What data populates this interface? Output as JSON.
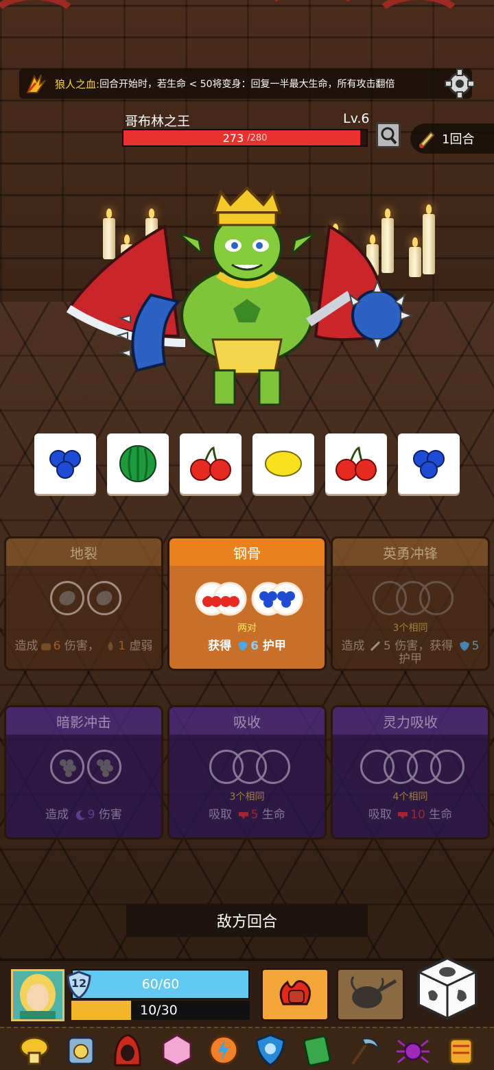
{
  "trait": {
    "icon": "werewolf-claw-icon",
    "name": "狼人之血:",
    "description": "回合开始时，若生命 < 50将变身：回复一半最大生命，所有攻击翻倍"
  },
  "settings_icon": "gear-icon",
  "enemy": {
    "name": "哥布林之王",
    "level": "Lv.6",
    "hp_current": "273",
    "hp_max": "/280",
    "hp_fraction": 0.975
  },
  "round": {
    "label": "1回合",
    "icon": "scroll-icon"
  },
  "dice": [
    {
      "face": "blueberry"
    },
    {
      "face": "watermelon"
    },
    {
      "face": "cherry"
    },
    {
      "face": "lemon"
    },
    {
      "face": "cherry"
    },
    {
      "face": "blueberry"
    }
  ],
  "skills": [
    {
      "title": "地裂",
      "theme": "brown",
      "slots": [
        "nut",
        "nut"
      ],
      "requirement": "",
      "effect_a": "造成",
      "value_a": "6",
      "effect_b": "伤害，",
      "value_b": "1",
      "effect_c": "虚弱"
    },
    {
      "title": "钢骨",
      "theme": "orange",
      "slots": [
        "cherry",
        "cherry",
        "blueberry",
        "blueberry"
      ],
      "requirement": "两对",
      "effect_a": "获得",
      "value_a": "6",
      "effect_b": "护甲"
    },
    {
      "title": "英勇冲锋",
      "theme": "brown",
      "slots": [
        "",
        "",
        ""
      ],
      "requirement": "3个相同",
      "effect_a": "造成",
      "value_a": "5",
      "effect_b": "伤害，获得",
      "value_b": "5",
      "effect_c": "护甲"
    },
    {
      "title": "暗影冲击",
      "theme": "purple",
      "slots": [
        "grape",
        "grape"
      ],
      "requirement": "",
      "effect_a": "造成",
      "value_a": "9",
      "effect_b": "伤害"
    },
    {
      "title": "吸收",
      "theme": "purple",
      "slots": [
        "",
        "",
        ""
      ],
      "requirement": "3个相同",
      "effect_a": "吸取",
      "value_a": "5",
      "effect_b": "生命"
    },
    {
      "title": "灵力吸收",
      "theme": "purple",
      "slots": [
        "",
        "",
        "",
        ""
      ],
      "requirement": "4个相同",
      "effect_a": "吸取",
      "value_a": "10",
      "effect_b": "生命"
    }
  ],
  "turn_banner": "敌方回合",
  "player": {
    "level": "12",
    "hp_text": "60/60",
    "hp_fraction": 1.0,
    "xp_text": "10/30",
    "xp_fraction": 0.333
  },
  "abilities": [
    "fire-fist-icon",
    "fly-swatter-icon"
  ],
  "relics": [
    "golden-mushroom-icon",
    "compass-armor-icon",
    "red-hood-icon",
    "crystal-dice-icon",
    "lightning-orb-icon",
    "blue-shield-gem-icon",
    "green-leaf-card-icon",
    "scythe-icon",
    "purple-spider-icon",
    "golden-lantern-icon"
  ]
}
